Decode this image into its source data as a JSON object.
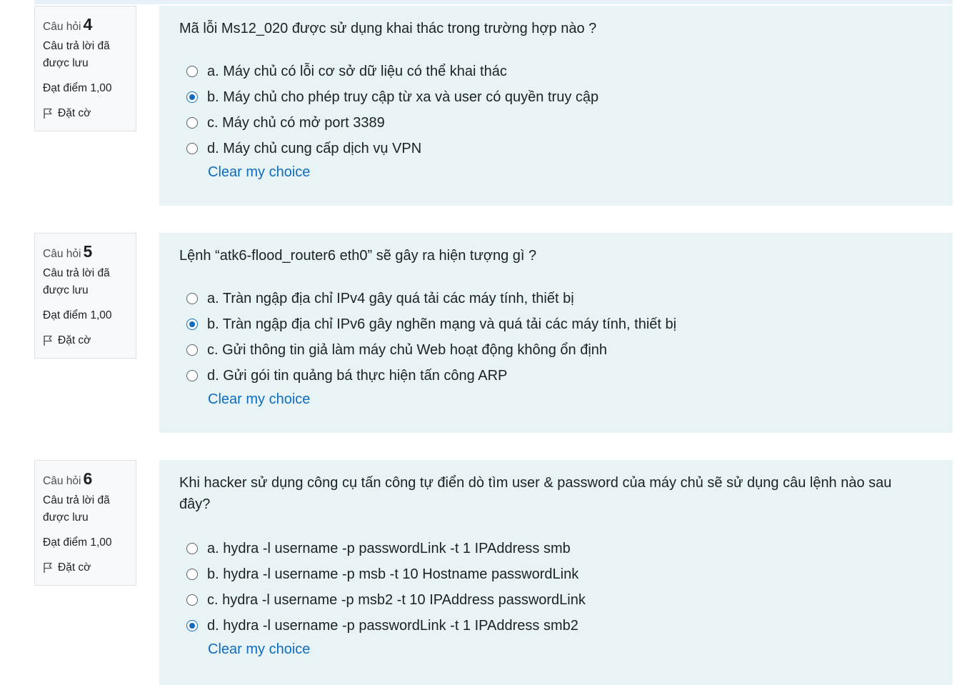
{
  "common": {
    "question_prefix": "Câu hỏi",
    "state": "Câu trả lời đã được lưu",
    "grade": "Đạt điểm 1,00",
    "flag": "Đặt cờ",
    "clear_choice": "Clear my choice"
  },
  "questions": [
    {
      "number": "4",
      "text": "Mã lỗi Ms12_020 được sử dụng khai thác trong trường hợp nào ?",
      "selected": 1,
      "answers": [
        "a. Máy chủ có lỗi cơ sở dữ liệu có thể khai thác",
        "b. Máy chủ cho phép truy cập từ xa và user có quyền truy cập",
        "c. Máy chủ có mở port 3389",
        "d. Máy chủ cung cấp dịch vụ VPN"
      ]
    },
    {
      "number": "5",
      "text": "Lệnh “atk6-flood_router6 eth0” sẽ gây ra hiện tượng gì ?",
      "selected": 1,
      "answers": [
        "a. Tràn ngập địa chỉ IPv4 gây quá tải các máy tính, thiết bị",
        "b. Tràn ngập địa chỉ IPv6 gây nghẽn mạng và quá tải các máy tính, thiết bị",
        "c. Gửi thông tin giả làm máy chủ Web hoạt động không ổn định",
        "d. Gửi gói tin quảng bá thực hiện tấn công ARP"
      ]
    },
    {
      "number": "6",
      "text": "Khi hacker sử dụng công cụ tấn công tự điển dò tìm user & password của máy chủ sẽ sử dụng câu lệnh nào sau đây?",
      "selected": 3,
      "answers": [
        "a. hydra -l username -p passwordLink -t 1 IPAddress smb",
        "b. hydra -l username -p msb -t 10 Hostname passwordLink",
        "c. hydra -l username -p msb2 -t 10 IPAddress passwordLink",
        "d. hydra -l username -p passwordLink -t 1 IPAddress smb2"
      ]
    }
  ]
}
